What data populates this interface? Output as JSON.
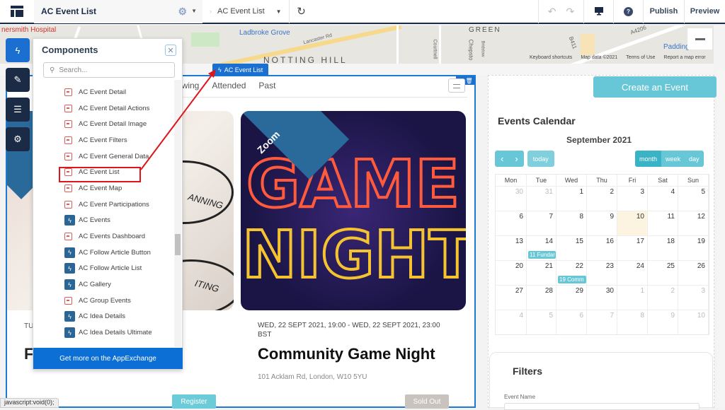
{
  "topbar": {
    "logo_icon": "layout-icon",
    "site_title": "AC Event List",
    "settings_icon": "gear-icon",
    "page_name": "AC Event List",
    "refresh_icon": "refresh-icon",
    "undo_icon": "undo-icon",
    "redo_icon": "redo-icon",
    "device_icon": "desktop-icon",
    "help_icon": "help-icon",
    "publish_label": "Publish",
    "preview_label": "Preview"
  },
  "map": {
    "labels": [
      "nersmith Hospital",
      "Ladbroke Grove",
      "NOTTING HILL",
      "GREEN",
      "Lancaster Rd",
      "Courtnell",
      "Chepsto",
      "Bridstow",
      "B411",
      "A4206",
      "Padding"
    ],
    "footer": [
      "Keyboard shortcuts",
      "Map data ©2021",
      "Terms of Use",
      "Report a map error"
    ]
  },
  "sidebar": {
    "buttons": [
      {
        "name": "components",
        "icon": "lightning-icon",
        "active": true
      },
      {
        "name": "theme",
        "icon": "brush-icon",
        "active": false
      },
      {
        "name": "page-structure",
        "icon": "list-icon",
        "active": false
      },
      {
        "name": "settings",
        "icon": "gear-icon",
        "active": false
      }
    ]
  },
  "components_panel": {
    "title": "Components",
    "search_placeholder": "Search...",
    "footer_label": "Get more on the AppExchange",
    "items": [
      {
        "label": "AC Event Detail",
        "icon": "calendar"
      },
      {
        "label": "AC Event Detail Actions",
        "icon": "calendar"
      },
      {
        "label": "AC Event Detail Image",
        "icon": "calendar"
      },
      {
        "label": "AC Event Filters",
        "icon": "calendar"
      },
      {
        "label": "AC Event General Data",
        "icon": "calendar"
      },
      {
        "label": "AC Event List",
        "icon": "calendar",
        "highlighted": true
      },
      {
        "label": "AC Event Map",
        "icon": "calendar"
      },
      {
        "label": "AC Event Participations",
        "icon": "calendar"
      },
      {
        "label": "AC Events",
        "icon": "lightning"
      },
      {
        "label": "AC Events Dashboard",
        "icon": "calendar"
      },
      {
        "label": "AC Follow Article Button",
        "icon": "lightning"
      },
      {
        "label": "AC Follow Article List",
        "icon": "lightning"
      },
      {
        "label": "AC Gallery",
        "icon": "lightning"
      },
      {
        "label": "AC Group Events",
        "icon": "calendar"
      },
      {
        "label": "AC Idea Details",
        "icon": "lightning"
      },
      {
        "label": "AC Idea Details Ultimate",
        "icon": "lightning"
      }
    ]
  },
  "event_list": {
    "component_tag": "AC Event List",
    "tabs": [
      "owing",
      "Attended",
      "Past"
    ],
    "cards": [
      {
        "badge": "",
        "date": "TU",
        "title": "F… e ...",
        "image_words": [
          "ANNING",
          "ITING"
        ],
        "button": "Register"
      },
      {
        "badge": "Zoom",
        "date": "WED, 22 SEPT 2021, 19:00 - WED, 22 SEPT 2021, 23:00 BST",
        "title": "Community Game Night",
        "location": "101 Acklam Rd, London, W10 5YU",
        "image_words": [
          "GAME",
          "NIGHT"
        ],
        "button": "Sold Out"
      }
    ]
  },
  "calendar": {
    "create_button": "Create an Event",
    "heading": "Events Calendar",
    "month": "September 2021",
    "nav": {
      "prev": "‹",
      "next": "›",
      "today": "today"
    },
    "views": [
      "month",
      "week",
      "day"
    ],
    "active_view": "month",
    "weekdays": [
      "Mon",
      "Tue",
      "Wed",
      "Thu",
      "Fri",
      "Sat",
      "Sun"
    ],
    "weeks": [
      [
        {
          "d": "30",
          "dim": true
        },
        {
          "d": "31",
          "dim": true
        },
        {
          "d": "1"
        },
        {
          "d": "2"
        },
        {
          "d": "3"
        },
        {
          "d": "4"
        },
        {
          "d": "5"
        }
      ],
      [
        {
          "d": "6"
        },
        {
          "d": "7"
        },
        {
          "d": "8"
        },
        {
          "d": "9"
        },
        {
          "d": "10",
          "today": true
        },
        {
          "d": "11"
        },
        {
          "d": "12"
        }
      ],
      [
        {
          "d": "13"
        },
        {
          "d": "14",
          "event": "11 Fundar"
        },
        {
          "d": "15"
        },
        {
          "d": "16"
        },
        {
          "d": "17"
        },
        {
          "d": "18"
        },
        {
          "d": "19"
        }
      ],
      [
        {
          "d": "20"
        },
        {
          "d": "21"
        },
        {
          "d": "22",
          "event": "19 Comm"
        },
        {
          "d": "23"
        },
        {
          "d": "24"
        },
        {
          "d": "25"
        },
        {
          "d": "26"
        }
      ],
      [
        {
          "d": "27"
        },
        {
          "d": "28"
        },
        {
          "d": "29"
        },
        {
          "d": "30"
        },
        {
          "d": "1",
          "dim": true
        },
        {
          "d": "2",
          "dim": true
        },
        {
          "d": "3",
          "dim": true
        }
      ],
      [
        {
          "d": "4",
          "dim": true
        },
        {
          "d": "5",
          "dim": true
        },
        {
          "d": "6",
          "dim": true
        },
        {
          "d": "7",
          "dim": true
        },
        {
          "d": "8",
          "dim": true
        },
        {
          "d": "9",
          "dim": true
        },
        {
          "d": "10",
          "dim": true
        }
      ]
    ]
  },
  "filters": {
    "title": "Filters",
    "event_name_label": "Event Name",
    "event_name_value": ""
  },
  "status_bar": "javascript:void(0);",
  "colors": {
    "accent": "#1a6fd0",
    "teal": "#67c7d6",
    "navy": "#1b2b45",
    "highlight": "#e0151b"
  }
}
